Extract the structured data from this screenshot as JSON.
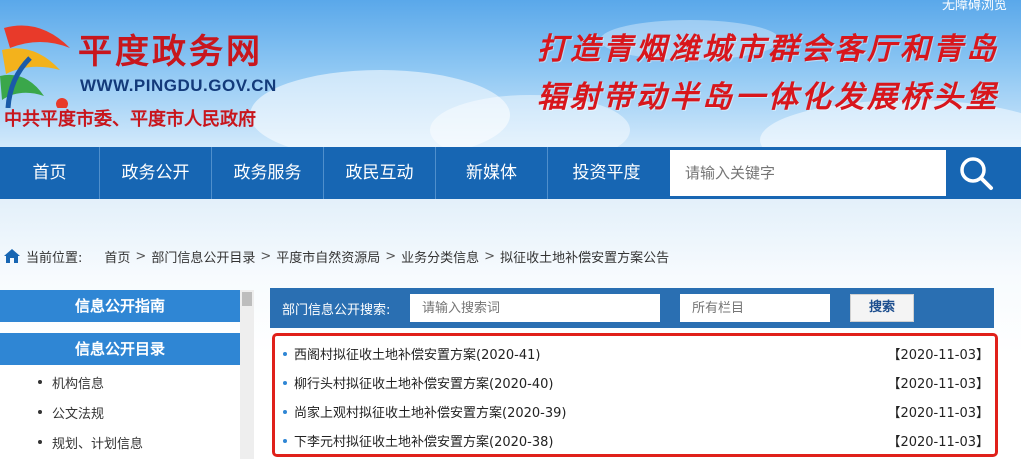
{
  "header": {
    "site_name": "平度政务网",
    "site_url": "WWW.PINGDU.GOV.CN",
    "org_name": "中共平度市委、平度市人民政府",
    "corner_link": "无障碍浏览",
    "slogan_line1": "打造青烟潍城市群会客厅和青岛",
    "slogan_line2": "辐射带动半岛一体化发展桥头堡"
  },
  "nav": {
    "items": [
      "首页",
      "政务公开",
      "政务服务",
      "政民互动",
      "新媒体",
      "投资平度"
    ],
    "search_placeholder": "请输入关键字"
  },
  "breadcrumb": {
    "label": "当前位置:",
    "items": [
      "首页",
      "部门信息公开目录",
      "平度市自然资源局",
      "业务分类信息",
      "拟征收土地补偿安置方案公告"
    ]
  },
  "sidebar": {
    "heading1": "信息公开指南",
    "heading2": "信息公开目录",
    "items": [
      "机构信息",
      "公文法规",
      "规划、计划信息"
    ]
  },
  "content_search": {
    "label": "部门信息公开搜索:",
    "keyword_placeholder": "请输入搜索词",
    "column_placeholder": "所有栏目",
    "button": "搜索"
  },
  "list": [
    {
      "title": "西阁村拟征收土地补偿安置方案(2020-41)",
      "date": "【2020-11-03】"
    },
    {
      "title": "柳行头村拟征收土地补偿安置方案(2020-40)",
      "date": "【2020-11-03】"
    },
    {
      "title": "尚家上观村拟征收土地补偿安置方案(2020-39)",
      "date": "【2020-11-03】"
    },
    {
      "title": "下李元村拟征收土地补偿安置方案(2020-38)",
      "date": "【2020-11-03】"
    }
  ],
  "colors": {
    "nav_blue": "#1766b3",
    "brand_red": "#c8161d",
    "highlight_red": "#e0201a",
    "sidebar_blue": "#2f86d4"
  }
}
